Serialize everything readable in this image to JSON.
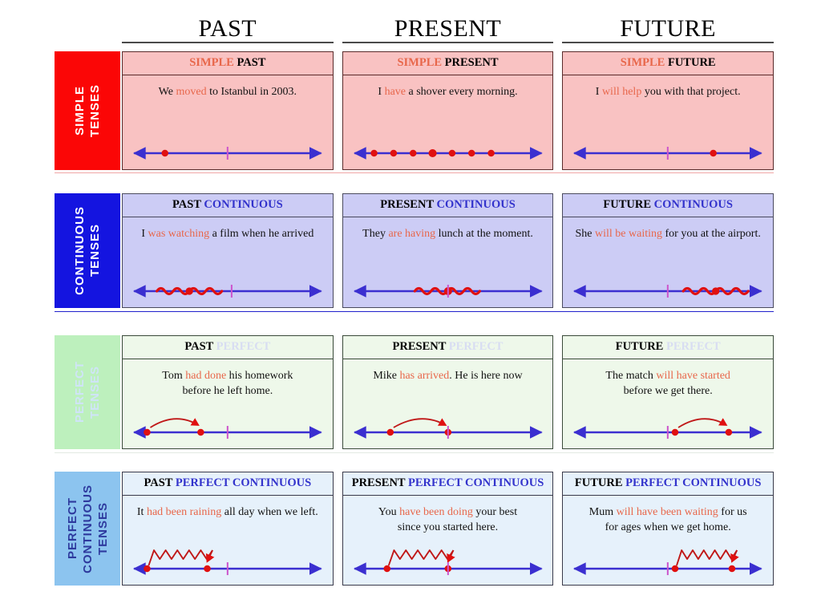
{
  "columns": [
    {
      "label": "PAST"
    },
    {
      "label": "PRESENT"
    },
    {
      "label": "FUTURE"
    }
  ],
  "colors": {
    "simple_accent": "#fb0606",
    "continuous_accent": "#1414e0",
    "perfect_accent": "#bdf0bd",
    "perfect_continuous_accent": "#8cc4ef",
    "verb_highlight": "#e8674b",
    "title_word2_simple": "#000000",
    "title_word2_continuous": "#3333cc",
    "title_word2_perfect": "#d8ddf2",
    "timeline_line": "#3b2fd0",
    "timeline_marker": "#e01010",
    "now_tick": "#cc55cc"
  },
  "rows": [
    {
      "side_words": [
        "SIMPLE",
        "TENSES"
      ],
      "cards": [
        {
          "title_a": "SIMPLE",
          "title_b": "PAST",
          "sentence_parts": [
            {
              "t": "We ",
              "hl": false
            },
            {
              "t": "moved",
              "hl": true
            },
            {
              "t": " to Istanbul in 2003.",
              "hl": false
            }
          ],
          "timeline": "past-point"
        },
        {
          "title_a": "SIMPLE",
          "title_b": "PRESENT",
          "sentence_parts": [
            {
              "t": "I ",
              "hl": false
            },
            {
              "t": "have",
              "hl": true
            },
            {
              "t": " a shover every morning.",
              "hl": false
            }
          ],
          "timeline": "repeated-points"
        },
        {
          "title_a": "SIMPLE",
          "title_b": "FUTURE",
          "sentence_parts": [
            {
              "t": "I ",
              "hl": false
            },
            {
              "t": "will help",
              "hl": true
            },
            {
              "t": " you with that project.",
              "hl": false
            }
          ],
          "timeline": "future-point"
        }
      ]
    },
    {
      "side_words": [
        "CONTINUOUS",
        "TENSES"
      ],
      "cards": [
        {
          "title_a": "PAST",
          "title_b": "CONTINUOUS",
          "sentence_parts": [
            {
              "t": "I ",
              "hl": false
            },
            {
              "t": "was watching",
              "hl": true
            },
            {
              "t": " a film when he arrived",
              "hl": false
            }
          ],
          "timeline": "wave-past"
        },
        {
          "title_a": "PRESENT",
          "title_b": "CONTINUOUS",
          "sentence_parts": [
            {
              "t": "They ",
              "hl": false
            },
            {
              "t": "are having",
              "hl": true
            },
            {
              "t": " lunch at the moment.",
              "hl": false
            }
          ],
          "timeline": "wave-now"
        },
        {
          "title_a": "FUTURE",
          "title_b": "CONTINUOUS",
          "sentence_parts": [
            {
              "t": "She ",
              "hl": false
            },
            {
              "t": "will be waiting",
              "hl": true
            },
            {
              "t": " for you at the airport.",
              "hl": false
            }
          ],
          "timeline": "wave-future"
        }
      ]
    },
    {
      "side_words": [
        "PERFECT",
        "TENSES"
      ],
      "cards": [
        {
          "title_a": "PAST",
          "title_b": "PERFECT",
          "sentence_parts": [
            {
              "t": "Tom ",
              "hl": false
            },
            {
              "t": "had done",
              "hl": true
            },
            {
              "t": " his homework",
              "hl": false
            },
            {
              "t": "\n",
              "hl": false
            },
            {
              "t": "before he left home.",
              "hl": false
            }
          ],
          "timeline": "arc-past"
        },
        {
          "title_a": "PRESENT",
          "title_b": "PERFECT",
          "sentence_parts": [
            {
              "t": "Mike ",
              "hl": false
            },
            {
              "t": "has arrived",
              "hl": true
            },
            {
              "t": ". He is here now",
              "hl": false
            }
          ],
          "timeline": "arc-now"
        },
        {
          "title_a": "FUTURE",
          "title_b": "PERFECT",
          "sentence_parts": [
            {
              "t": "The match ",
              "hl": false
            },
            {
              "t": "will have started",
              "hl": true
            },
            {
              "t": "\n",
              "hl": false
            },
            {
              "t": "before we get there.",
              "hl": false
            }
          ],
          "timeline": "arc-future"
        }
      ]
    },
    {
      "side_words": [
        "PERFECT",
        "CONTINUOUS",
        "TENSES"
      ],
      "cards": [
        {
          "title_a": "PAST",
          "title_b": "PERFECT CONTINUOUS",
          "sentence_parts": [
            {
              "t": "It ",
              "hl": false
            },
            {
              "t": "had been raining",
              "hl": true
            },
            {
              "t": " all day when we left.",
              "hl": false
            }
          ],
          "timeline": "zig-past"
        },
        {
          "title_a": "PRESENT",
          "title_b": "PERFECT CONTINUOUS",
          "sentence_parts": [
            {
              "t": "You ",
              "hl": false
            },
            {
              "t": "have been doing",
              "hl": true
            },
            {
              "t": " your best",
              "hl": false
            },
            {
              "t": "\n",
              "hl": false
            },
            {
              "t": "since you started here.",
              "hl": false
            }
          ],
          "timeline": "zig-now"
        },
        {
          "title_a": "FUTURE",
          "title_b": "PERFECT CONTINUOUS",
          "sentence_parts": [
            {
              "t": "Mum ",
              "hl": false
            },
            {
              "t": "will have been waiting",
              "hl": true
            },
            {
              "t": " for us",
              "hl": false
            },
            {
              "t": "\n",
              "hl": false
            },
            {
              "t": "for ages when we get home.",
              "hl": false
            }
          ],
          "timeline": "zig-future"
        }
      ]
    }
  ]
}
